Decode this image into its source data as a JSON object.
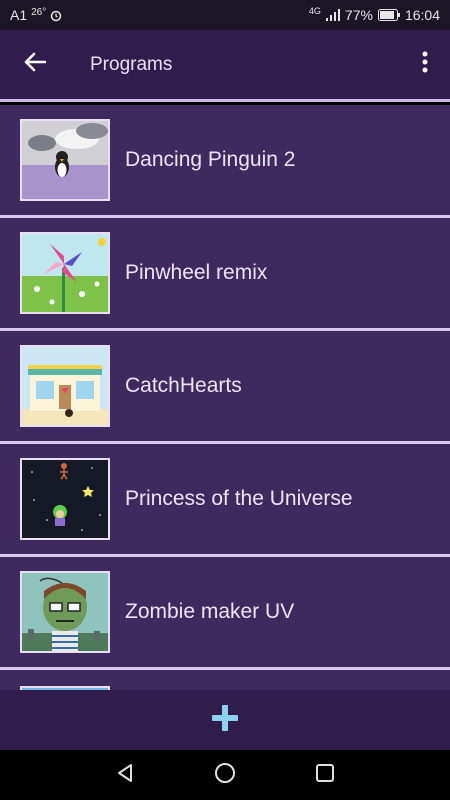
{
  "status_bar": {
    "carrier": "A1",
    "temperature": "26°",
    "network": "4G",
    "battery": "77%",
    "time": "16:04",
    "icons": [
      "alarm-icon",
      "signal-icon",
      "battery-icon"
    ]
  },
  "app_bar": {
    "title": "Programs",
    "back_icon": "arrow-left-icon",
    "menu_icon": "more-vertical-icon"
  },
  "programs": [
    {
      "name": "Dancing Pinguin 2",
      "thumbnail": "penguin-thumbnail"
    },
    {
      "name": "Pinwheel remix",
      "thumbnail": "pinwheel-thumbnail"
    },
    {
      "name": "CatchHearts",
      "thumbnail": "shop-thumbnail"
    },
    {
      "name": "Princess of the Universe",
      "thumbnail": "space-thumbnail"
    },
    {
      "name": "Zombie maker UV",
      "thumbnail": "zombie-thumbnail"
    }
  ],
  "bottom_bar": {
    "add_icon": "plus-icon"
  },
  "nav_bar": {
    "icons": [
      "back-triangle-icon",
      "home-circle-icon",
      "recents-square-icon"
    ]
  },
  "colors": {
    "app_bar": "#301d4d",
    "list_item": "#3e2a5f",
    "divider": "#d8c9ef",
    "add_icon": "#8ed1ee"
  }
}
